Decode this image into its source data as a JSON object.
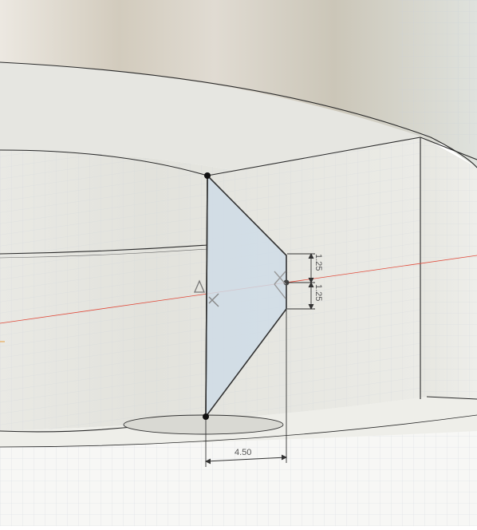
{
  "viewport": {
    "background_color": "#ffffff",
    "grid_color": "#c9d0d8",
    "red_axis_color": "#e04a3a",
    "sketch_fill_color": "#cfdce6"
  },
  "dimensions": {
    "upper_offset": "1.25",
    "lower_offset": "1.25",
    "width": "4.50"
  },
  "icons": {
    "constraint_triangle": "triangle-constraint-icon",
    "constraint_x": "midpoint-x-icon"
  }
}
